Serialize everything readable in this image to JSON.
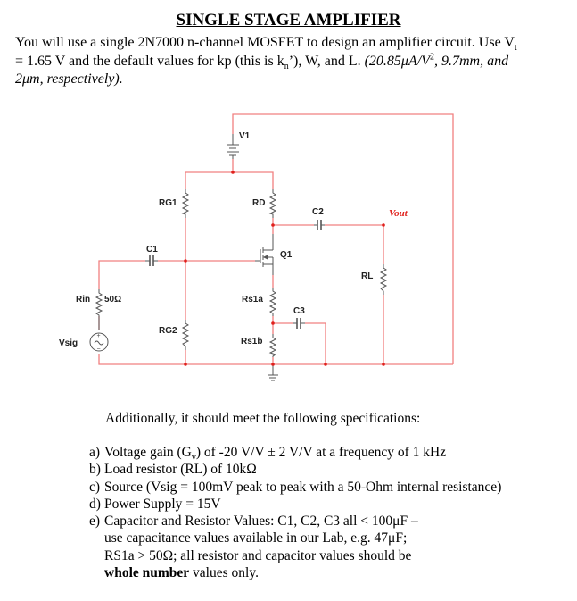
{
  "document": {
    "title": "SINGLE STAGE AMPLIFIER",
    "intro": {
      "line1_a": "You will use a single 2N7000 n-channel MOSFET to design an amplifier circuit. Use V",
      "line1_sub": "t",
      "line2_a": "= 1.65 V and the default values for kp (this is k",
      "line2_sub": "n",
      "line2_b": "’), W, and L. ",
      "line2_italic_a": "(20.85",
      "line2_italic_mu": "μA/V",
      "line2_sup": "2",
      "line2_italic_b": ", 9.7mm, and",
      "line3_italic": "2μm, respectively)."
    }
  },
  "circuit": {
    "wire_color": "#f08080",
    "node_color": "#e0201c",
    "component_color": "#444444",
    "labels": {
      "v1": "V1",
      "rg1": "RG1",
      "rd": "RD",
      "c2": "C2",
      "vout": "Vout",
      "c1": "C1",
      "q1": "Q1",
      "rl": "RL",
      "rin": "Rin",
      "rin_value": "50Ω",
      "rs1a": "Rs1a",
      "c3": "C3",
      "rg2": "RG2",
      "rs1b": "Rs1b",
      "vsig": "Vsig",
      "plus": "+",
      "minus": "−"
    }
  },
  "specifications": {
    "intro": "Additionally, it should meet the following specifications:",
    "items": [
      {
        "mark": "a)",
        "text": "Voltage gain (G",
        "sub": "v",
        "text_after": ") of -20 V/V ± 2 V/V at a frequency of 1 kHz"
      },
      {
        "mark": "b)",
        "text": "Load resistor (RL) of 10kΩ"
      },
      {
        "mark": "c)",
        "text": "Source (Vsig = 100mV peak to peak with a 50-Ohm internal resistance)"
      },
      {
        "mark": "d)",
        "text": "Power Supply = 15V"
      },
      {
        "mark": "e)",
        "text": "Capacitor and Resistor Values: C1, C2, C3 all < 100μF –"
      }
    ],
    "item_e_continuation": [
      "use capacitance values available in our Lab, e.g. 47μF;",
      "RS1a > 50Ω; all resistor and capacitor values should be"
    ],
    "item_e_last_bold": "whole number",
    "item_e_last_rest": " values only."
  }
}
